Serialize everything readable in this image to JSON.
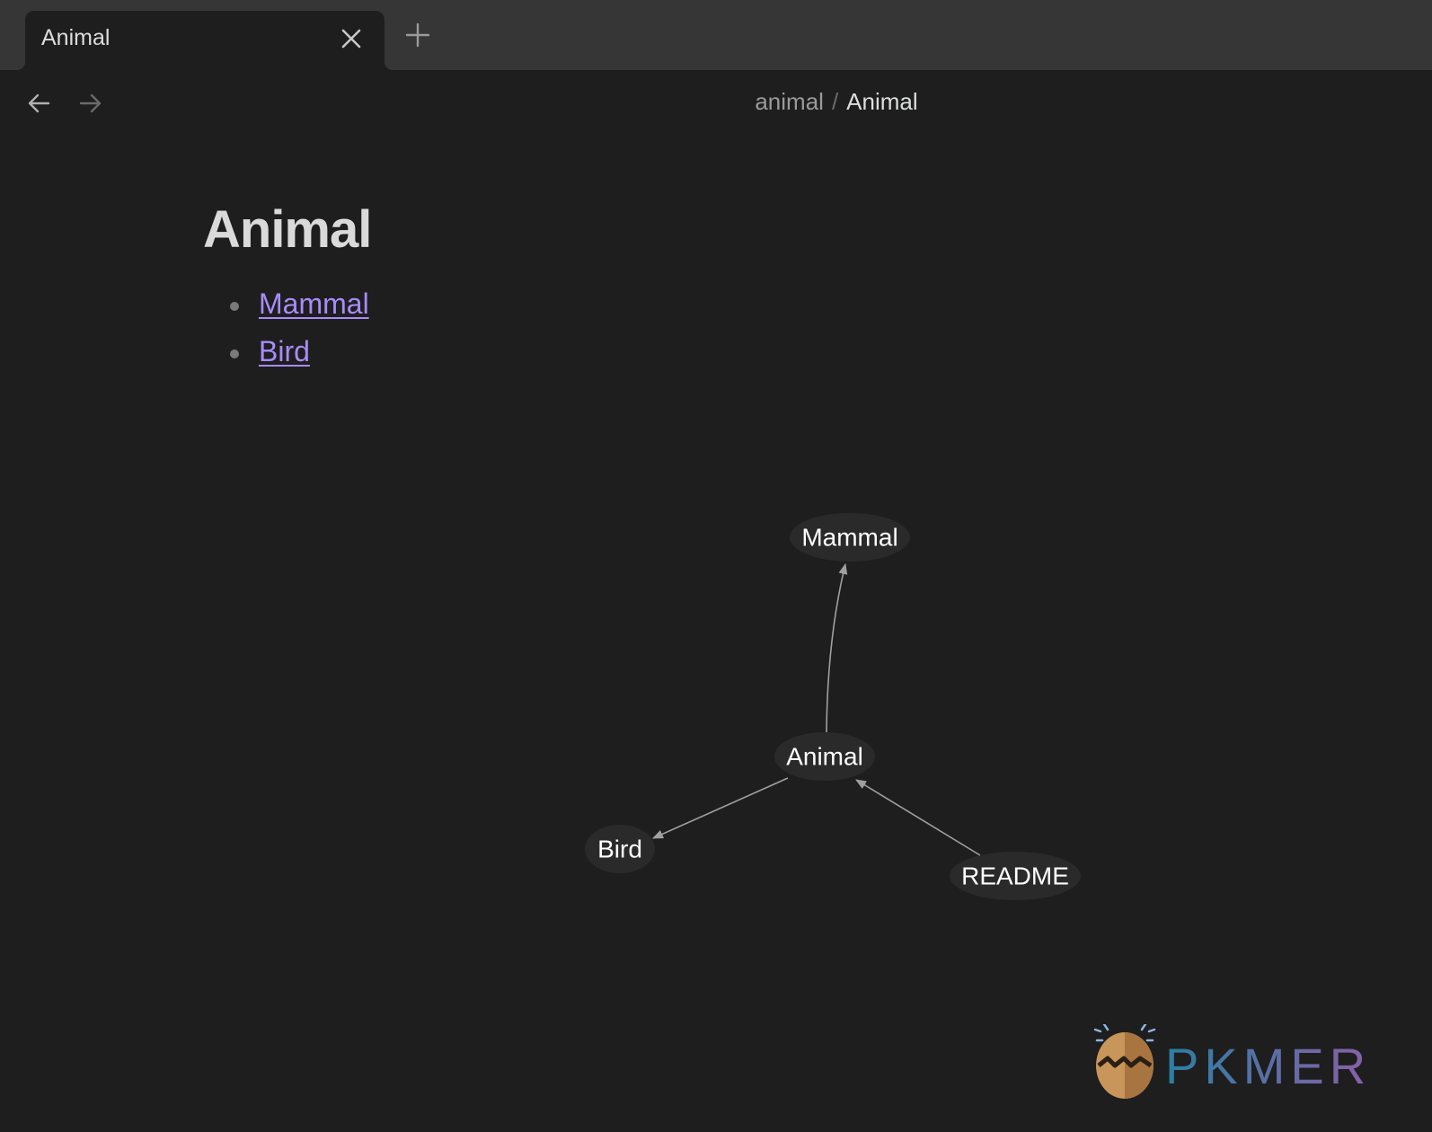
{
  "tab": {
    "title": "Animal",
    "close_icon": "close-icon",
    "new_tab_icon": "plus-icon"
  },
  "nav": {
    "back_icon": "arrow-left-icon",
    "forward_icon": "arrow-right-icon"
  },
  "breadcrumb": {
    "folder": "animal",
    "separator": "/",
    "current": "Animal"
  },
  "note": {
    "title": "Animal",
    "links": [
      {
        "label": "Mammal"
      },
      {
        "label": "Bird"
      }
    ]
  },
  "graph": {
    "nodes": {
      "mammal": "Mammal",
      "animal": "Animal",
      "bird": "Bird",
      "readme": "README"
    },
    "edges": [
      {
        "from": "Animal",
        "to": "Mammal"
      },
      {
        "from": "Animal",
        "to": "Bird"
      },
      {
        "from": "README",
        "to": "Animal"
      }
    ]
  },
  "watermark": {
    "text": "PKMER",
    "icon": "egg-logo-icon"
  },
  "colors": {
    "background": "#1e1e1e",
    "tabbar": "#363636",
    "link": "#a88bfa",
    "node_fill": "#2a2a2a",
    "edge": "#a0a0a0"
  }
}
